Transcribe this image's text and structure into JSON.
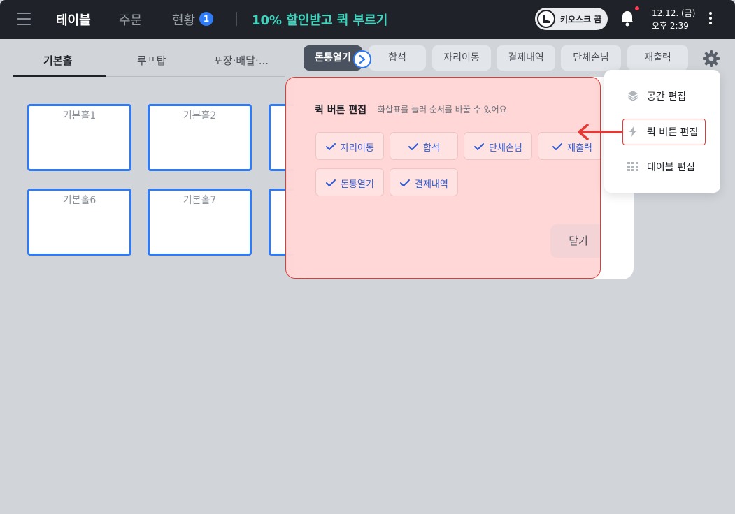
{
  "topbar": {
    "nav_table": "테이블",
    "nav_order": "주문",
    "nav_status": "현황",
    "status_badge": "1",
    "promo": "10% 할인받고 퀵 부르기",
    "kiosk_label": "키오스크 끔",
    "date": "12.12. (금)",
    "time": "오후 2:39"
  },
  "halls": [
    {
      "label": "기본홀"
    },
    {
      "label": "루프탑"
    },
    {
      "label": "포장·배달·..."
    }
  ],
  "quick_buttons": [
    {
      "label": "돈통열기"
    },
    {
      "label": "합석"
    },
    {
      "label": "자리이동"
    },
    {
      "label": "결제내역"
    },
    {
      "label": "단체손님"
    },
    {
      "label": "재출력"
    }
  ],
  "tables": [
    {
      "name": "기본홀1"
    },
    {
      "name": "기본홀2"
    },
    {
      "name": "기본홀6"
    },
    {
      "name": "기본홀7"
    }
  ],
  "dropdown": {
    "items": [
      {
        "label": "공간 편집"
      },
      {
        "label": "퀵 버튼 편집"
      },
      {
        "label": "테이블 편집"
      }
    ]
  },
  "modal": {
    "title": "퀵 버튼 편집",
    "subtitle": "화살표를 눌러 순서를 바꿀 수 있어요",
    "chips": [
      {
        "label": "자리이동"
      },
      {
        "label": "합석"
      },
      {
        "label": "단체손님"
      },
      {
        "label": "재출력"
      },
      {
        "label": "돈통열기"
      },
      {
        "label": "결제내역"
      }
    ],
    "close_label": "닫기"
  },
  "colors": {
    "accent": "#2f7bf5",
    "promo": "#3fd6c0",
    "annotation": "#e53935"
  }
}
